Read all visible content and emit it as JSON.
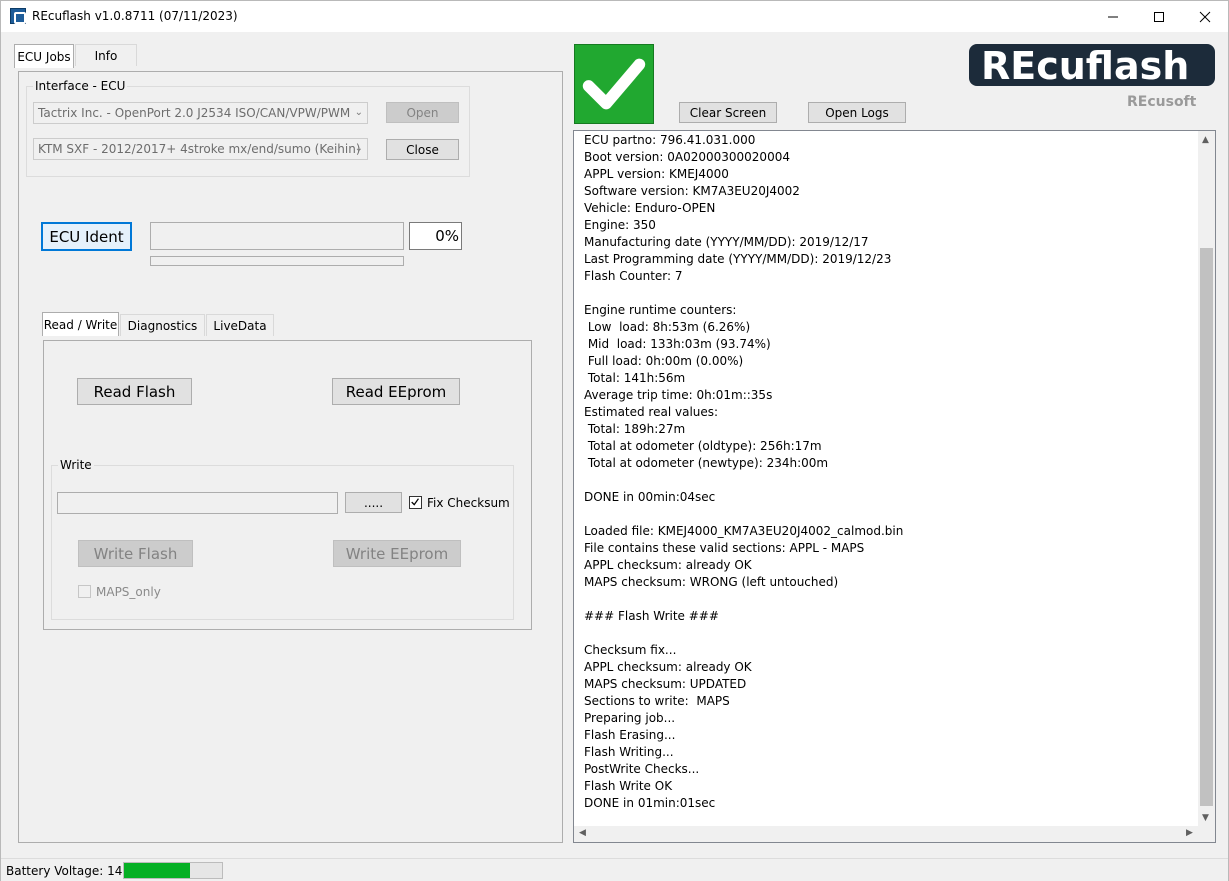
{
  "window": {
    "title": "REcuflash  v1.0.8711 (07/11/2023)"
  },
  "tabs": {
    "ecu_jobs": "ECU Jobs",
    "info": "Info"
  },
  "interface": {
    "group_label": "Interface - ECU",
    "adapter_select": "Tactrix Inc. - OpenPort 2.0 J2534 ISO/CAN/VPW/PWM",
    "ecu_select": "KTM SXF - 2012/2017+ 4stroke mx/end/sumo (Keihin)",
    "open_label": "Open",
    "close_label": "Close"
  },
  "ident": {
    "button_label": "ECU Ident",
    "progress_text": "0%",
    "progress_fraction": 0
  },
  "subtabs": {
    "read_write": "Read / Write",
    "diagnostics": "Diagnostics",
    "livedata": "LiveData"
  },
  "readwrite": {
    "read_flash": "Read Flash",
    "read_eeprom": "Read EEprom",
    "write_group": "Write",
    "file_path": "",
    "browse_label": ".....",
    "fix_checksum_label": "Fix Checksum",
    "fix_checksum_checked": true,
    "write_flash": "Write Flash",
    "write_eeprom": "Write EEprom",
    "maps_only_label": "MAPS_only",
    "maps_only_checked": false
  },
  "status_check": {
    "state": "success",
    "color": "#21a830"
  },
  "toolbar": {
    "clear_screen": "Clear Screen",
    "open_logs": "Open Logs"
  },
  "logo": {
    "brand": "REcuflash",
    "company": "REcusoft"
  },
  "log_lines": [
    "ECU partno: 796.41.031.000",
    "Boot version: 0A02000300020004",
    "APPL version: KMEJ4000",
    "Software version: KM7A3EU20J4002",
    "Vehicle: Enduro-OPEN",
    "Engine: 350",
    "Manufacturing date (YYYY/MM/DD): 2019/12/17",
    "Last Programming date (YYYY/MM/DD): 2019/12/23",
    "Flash Counter: 7",
    "",
    "Engine runtime counters:",
    " Low  load: 8h:53m (6.26%)",
    " Mid  load: 133h:03m (93.74%)",
    " Full load: 0h:00m (0.00%)",
    " Total: 141h:56m",
    "Average trip time: 0h:01m::35s",
    "Estimated real values:",
    " Total: 189h:27m",
    " Total at odometer (oldtype): 256h:17m",
    " Total at odometer (newtype): 234h:00m",
    "",
    "DONE in 00min:04sec",
    "",
    "Loaded file: KMEJ4000_KM7A3EU20J4002_calmod.bin",
    "File contains these valid sections: APPL - MAPS",
    "APPL checksum: already OK",
    "MAPS checksum: WRONG (left untouched)",
    "",
    "### Flash Write ###",
    "",
    "Checksum fix...",
    "APPL checksum: already OK",
    "MAPS checksum: UPDATED",
    "Sections to write:  MAPS",
    "Preparing job...",
    "Flash Erasing...",
    "Flash Writing...",
    "PostWrite Checks...",
    "Flash Write OK",
    "DONE in 01min:01sec"
  ],
  "statusbar": {
    "battery_label": "Battery Voltage: 14.05",
    "battery_fraction": 0.67,
    "battery_color": "#06b025"
  }
}
